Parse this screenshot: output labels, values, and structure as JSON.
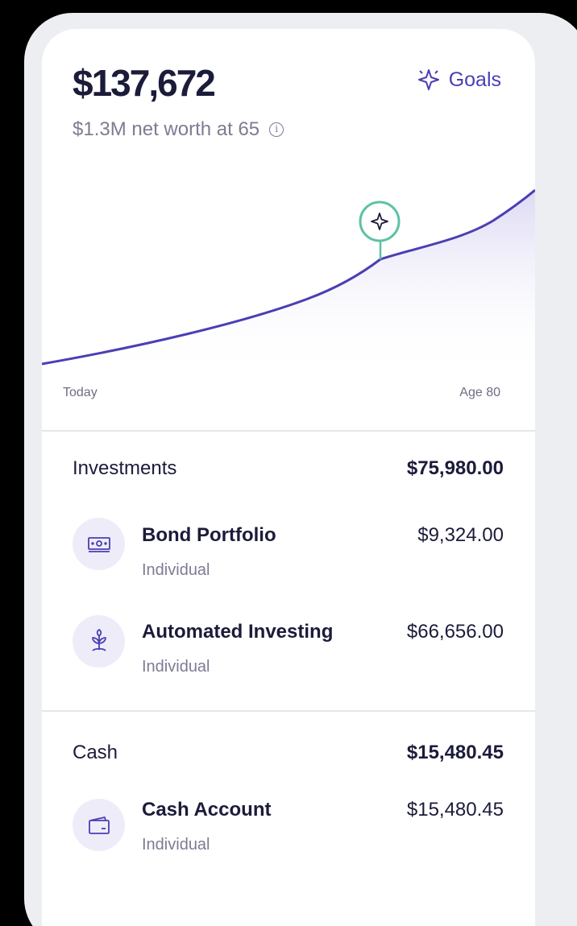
{
  "header": {
    "balance": "$137,672",
    "goals_label": "Goals",
    "net_worth_note": "$1.3M net worth at 65",
    "info_glyph": "i"
  },
  "projection_chart": {
    "start_label": "Today",
    "end_label": "Age 80",
    "milestone_icon": "sparkle-icon",
    "line_color": "#4a3fb4",
    "milestone_color": "#5bc2a3"
  },
  "sections": [
    {
      "title": "Investments",
      "total": "$75,980.00",
      "accounts": [
        {
          "name": "Bond Portfolio",
          "type": "Individual",
          "value": "$9,324.00",
          "icon": "cash-bills-icon"
        },
        {
          "name": "Automated Investing",
          "type": "Individual",
          "value": "$66,656.00",
          "icon": "plant-sprout-icon"
        }
      ]
    },
    {
      "title": "Cash",
      "total": "$15,480.45",
      "accounts": [
        {
          "name": "Cash Account",
          "type": "Individual",
          "value": "$15,480.45",
          "icon": "wallet-icon"
        }
      ]
    }
  ],
  "colors": {
    "accent": "#4a3fb4",
    "text_primary": "#1b1b3a",
    "text_secondary": "#7c7c93",
    "icon_bg": "#eeecf8"
  }
}
